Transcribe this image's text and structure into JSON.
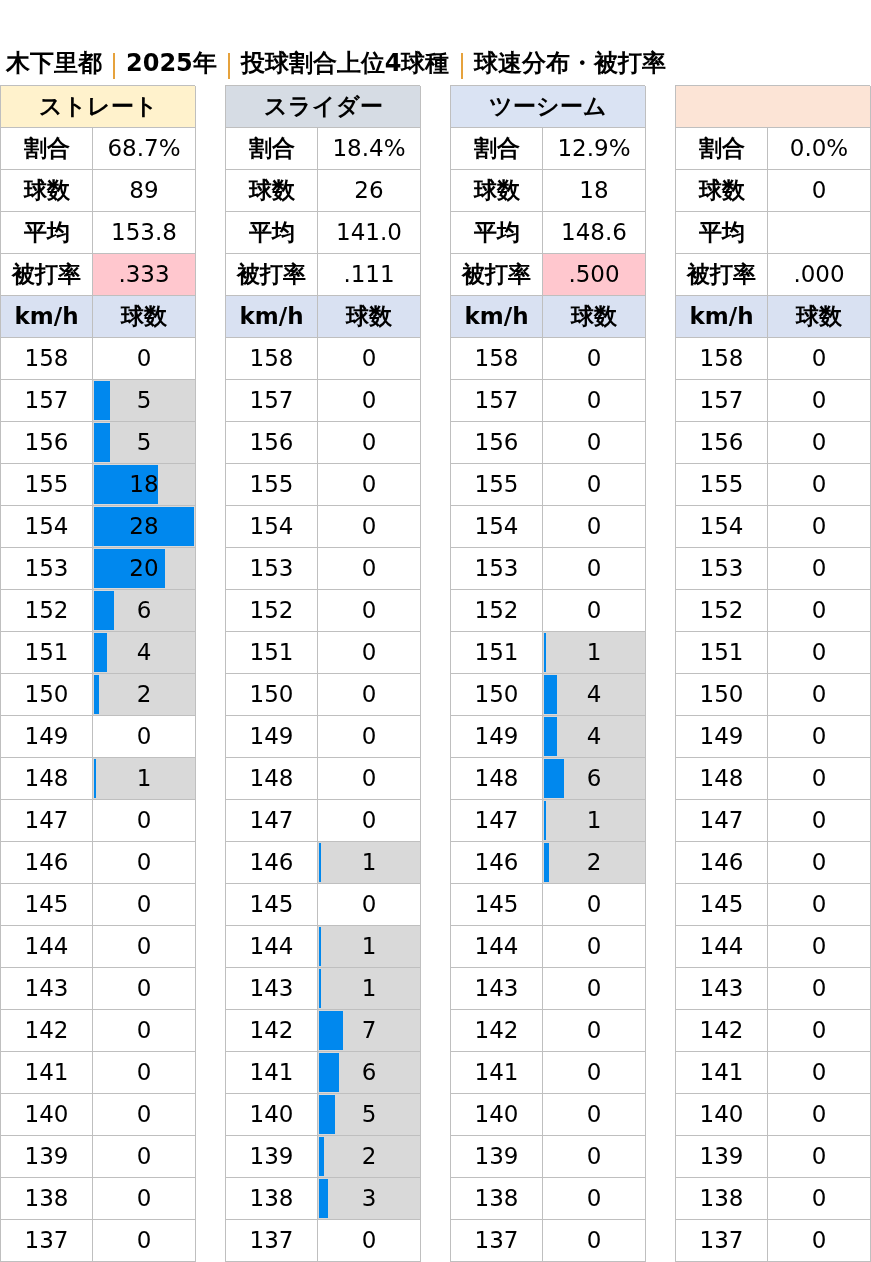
{
  "title": [
    "木下里都",
    "2025年",
    "投球割合上位4球種",
    "球速分布・被打率"
  ],
  "panels": [
    {
      "name": "ストレート",
      "color": "#fff2cc",
      "stats": [
        {
          "label": "割合",
          "value": "68.7%"
        },
        {
          "label": "球数",
          "value": "89"
        },
        {
          "label": "平均",
          "value": "153.8"
        },
        {
          "label": "被打率",
          "value": ".333",
          "highlight": true
        }
      ],
      "columns": [
        "km/h",
        "球数"
      ],
      "rows": [
        {
          "speed": "158",
          "count": "0"
        },
        {
          "speed": "157",
          "count": "5",
          "level": 0.179
        },
        {
          "speed": "156",
          "count": "5",
          "level": 0.179
        },
        {
          "speed": "155",
          "count": "18",
          "level": 0.643
        },
        {
          "speed": "154",
          "count": "28",
          "level": 1
        },
        {
          "speed": "153",
          "count": "20",
          "level": 0.714
        },
        {
          "speed": "152",
          "count": "6",
          "level": 0.214
        },
        {
          "speed": "151",
          "count": "4",
          "level": 0.143
        },
        {
          "speed": "150",
          "count": "2",
          "level": 0.071
        },
        {
          "speed": "149",
          "count": "0"
        },
        {
          "speed": "148",
          "count": "1",
          "level": 0.036
        },
        {
          "speed": "147",
          "count": "0"
        },
        {
          "speed": "146",
          "count": "0"
        },
        {
          "speed": "145",
          "count": "0"
        },
        {
          "speed": "144",
          "count": "0"
        },
        {
          "speed": "143",
          "count": "0"
        },
        {
          "speed": "142",
          "count": "0"
        },
        {
          "speed": "141",
          "count": "0"
        },
        {
          "speed": "140",
          "count": "0"
        },
        {
          "speed": "139",
          "count": "0"
        },
        {
          "speed": "138",
          "count": "0"
        },
        {
          "speed": "137",
          "count": "0"
        }
      ]
    },
    {
      "name": "スライダー",
      "color": "#d6dce4",
      "stats": [
        {
          "label": "割合",
          "value": "18.4%"
        },
        {
          "label": "球数",
          "value": "26"
        },
        {
          "label": "平均",
          "value": "141.0"
        },
        {
          "label": "被打率",
          "value": ".111",
          "highlight": false
        }
      ],
      "columns": [
        "km/h",
        "球数"
      ],
      "rows": [
        {
          "speed": "158",
          "count": "0"
        },
        {
          "speed": "157",
          "count": "0"
        },
        {
          "speed": "156",
          "count": "0"
        },
        {
          "speed": "155",
          "count": "0"
        },
        {
          "speed": "154",
          "count": "0"
        },
        {
          "speed": "153",
          "count": "0"
        },
        {
          "speed": "152",
          "count": "0"
        },
        {
          "speed": "151",
          "count": "0"
        },
        {
          "speed": "150",
          "count": "0"
        },
        {
          "speed": "149",
          "count": "0"
        },
        {
          "speed": "148",
          "count": "0"
        },
        {
          "speed": "147",
          "count": "0"
        },
        {
          "speed": "146",
          "count": "1",
          "level": 0.036
        },
        {
          "speed": "145",
          "count": "0"
        },
        {
          "speed": "144",
          "count": "1",
          "level": 0.036
        },
        {
          "speed": "143",
          "count": "1",
          "level": 0.036
        },
        {
          "speed": "142",
          "count": "7",
          "level": 0.25
        },
        {
          "speed": "141",
          "count": "6",
          "level": 0.214
        },
        {
          "speed": "140",
          "count": "5",
          "level": 0.179
        },
        {
          "speed": "139",
          "count": "2",
          "level": 0.071
        },
        {
          "speed": "138",
          "count": "3",
          "level": 0.107
        },
        {
          "speed": "137",
          "count": "0"
        }
      ]
    },
    {
      "name": "ツーシーム",
      "color": "#dae3f3",
      "stats": [
        {
          "label": "割合",
          "value": "12.9%"
        },
        {
          "label": "球数",
          "value": "18"
        },
        {
          "label": "平均",
          "value": "148.6"
        },
        {
          "label": "被打率",
          "value": ".500",
          "highlight": true
        }
      ],
      "columns": [
        "km/h",
        "球数"
      ],
      "rows": [
        {
          "speed": "158",
          "count": "0"
        },
        {
          "speed": "157",
          "count": "0"
        },
        {
          "speed": "156",
          "count": "0"
        },
        {
          "speed": "155",
          "count": "0"
        },
        {
          "speed": "154",
          "count": "0"
        },
        {
          "speed": "153",
          "count": "0"
        },
        {
          "speed": "152",
          "count": "0"
        },
        {
          "speed": "151",
          "count": "1",
          "level": 0.036
        },
        {
          "speed": "150",
          "count": "4",
          "level": 0.143
        },
        {
          "speed": "149",
          "count": "4",
          "level": 0.143
        },
        {
          "speed": "148",
          "count": "6",
          "level": 0.214
        },
        {
          "speed": "147",
          "count": "1",
          "level": 0.036
        },
        {
          "speed": "146",
          "count": "2",
          "level": 0.071
        },
        {
          "speed": "145",
          "count": "0"
        },
        {
          "speed": "144",
          "count": "0"
        },
        {
          "speed": "143",
          "count": "0"
        },
        {
          "speed": "142",
          "count": "0"
        },
        {
          "speed": "141",
          "count": "0"
        },
        {
          "speed": "140",
          "count": "0"
        },
        {
          "speed": "139",
          "count": "0"
        },
        {
          "speed": "138",
          "count": "0"
        },
        {
          "speed": "137",
          "count": "0"
        }
      ]
    },
    {
      "color": "#fce4d6",
      "stats": [
        {
          "label": "割合",
          "value": "0.0%"
        },
        {
          "label": "球数",
          "value": "0"
        },
        {
          "label": "平均"
        },
        {
          "label": "被打率",
          "value": ".000",
          "highlight": false
        }
      ],
      "columns": [
        "km/h",
        "球数"
      ],
      "rows": [
        {
          "speed": "158",
          "count": "0"
        },
        {
          "speed": "157",
          "count": "0"
        },
        {
          "speed": "156",
          "count": "0"
        },
        {
          "speed": "155",
          "count": "0"
        },
        {
          "speed": "154",
          "count": "0"
        },
        {
          "speed": "153",
          "count": "0"
        },
        {
          "speed": "152",
          "count": "0"
        },
        {
          "speed": "151",
          "count": "0"
        },
        {
          "speed": "150",
          "count": "0"
        },
        {
          "speed": "149",
          "count": "0"
        },
        {
          "speed": "148",
          "count": "0"
        },
        {
          "speed": "147",
          "count": "0"
        },
        {
          "speed": "146",
          "count": "0"
        },
        {
          "speed": "145",
          "count": "0"
        },
        {
          "speed": "144",
          "count": "0"
        },
        {
          "speed": "143",
          "count": "0"
        },
        {
          "speed": "142",
          "count": "0"
        },
        {
          "speed": "141",
          "count": "0"
        },
        {
          "speed": "140",
          "count": "0"
        },
        {
          "speed": "139",
          "count": "0"
        },
        {
          "speed": "138",
          "count": "0"
        },
        {
          "speed": "137",
          "count": "0"
        }
      ]
    }
  ]
}
